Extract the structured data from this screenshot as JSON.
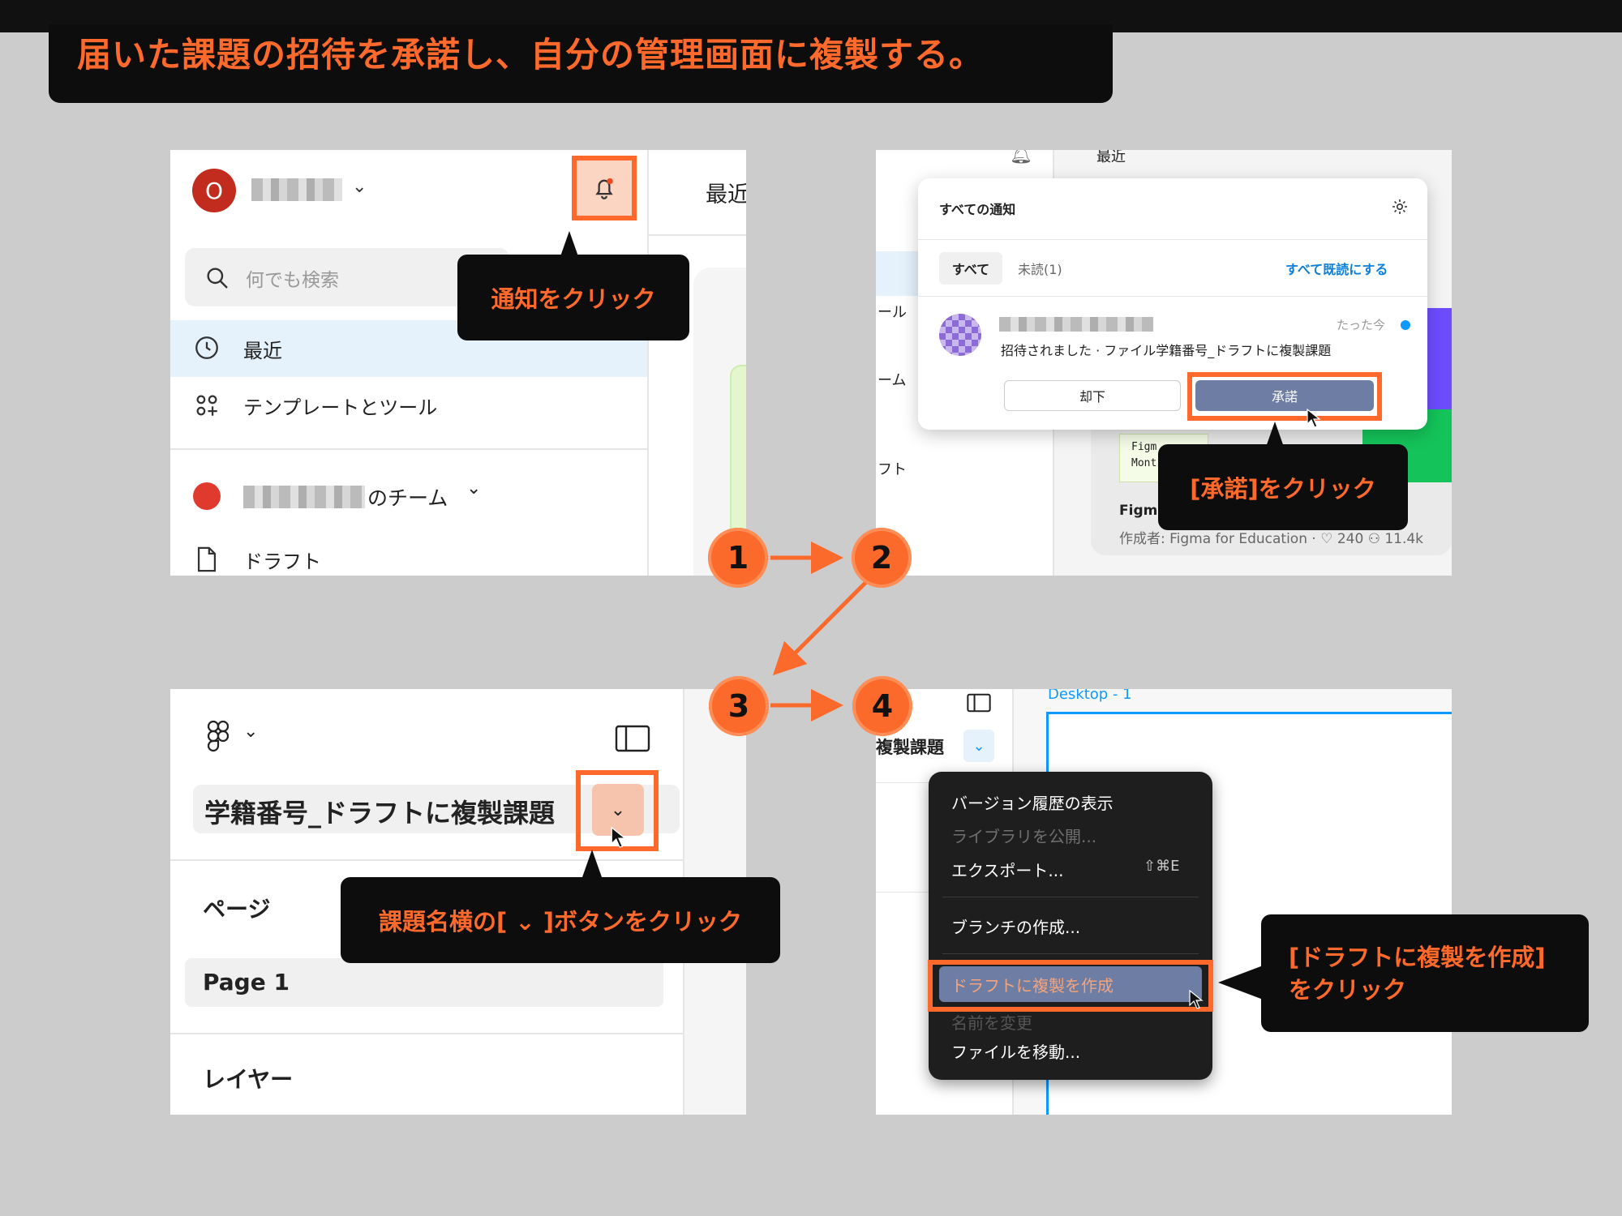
{
  "title": "届いた課題の招待を承諾し、自分の管理画面に複製する。",
  "steps": [
    "1",
    "2",
    "3",
    "4"
  ],
  "panel1": {
    "avatar_letter": "O",
    "search_placeholder": "何でも検索",
    "nav": [
      {
        "label": "最近",
        "icon": "clock-icon"
      },
      {
        "label": "テンプレートとツール",
        "icon": "templates-icon"
      }
    ],
    "team_suffix": "のチーム",
    "drafts_label": "ドラフト",
    "right_tab": "最近"
  },
  "callout1": "通知をクリック",
  "panel2": {
    "header_recent": "最近",
    "notif_title": "すべての通知",
    "tab_all": "すべて",
    "tab_unread": "未読(1)",
    "mark_all_read": "すべて既読にする",
    "time": "たった今",
    "message": "招待されました · ファイル学籍番号_ドラフトに複製課題",
    "decline": "却下",
    "accept": "承諾",
    "side_labels": [
      "ール",
      "ーム",
      "フト"
    ],
    "card_code": "Figm\nMont",
    "card_title": "Figma",
    "card_meta": "作成者: Figma for Education · ♡ 240  ⚇ 11.4k"
  },
  "callout2": "[承諾]をクリック",
  "panel3": {
    "file_name": "学籍番号_ドラフトに複製課題",
    "pages_label": "ページ",
    "page_item": "Page 1",
    "layers_label": "レイヤー"
  },
  "callout3": "課題名横の[ ⌄ ]ボタンをクリック",
  "panel4": {
    "frame_label": "Desktop - 1",
    "file_name_partial": "複製課題",
    "menu": [
      {
        "label": "バージョン履歴の表示",
        "state": "normal",
        "shortcut": ""
      },
      {
        "label": "ライブラリを公開...",
        "state": "disabled",
        "shortcut": ""
      },
      {
        "label": "エクスポート...",
        "state": "normal",
        "shortcut": "⇧⌘E"
      },
      {
        "label": "ブランチの作成...",
        "state": "normal",
        "shortcut": ""
      },
      {
        "label": "ドラフトに複製を作成",
        "state": "selected",
        "shortcut": ""
      },
      {
        "label": "名前を変更",
        "state": "disabled",
        "shortcut": ""
      },
      {
        "label": "ファイルを移動...",
        "state": "normal",
        "shortcut": ""
      }
    ]
  },
  "callout4": "[ドラフトに複製を作成]\nをクリック",
  "colors": {
    "accent": "#ff6a2c",
    "callout_bg": "#0d0d0d",
    "selected_bg": "#e5f1fb",
    "accept_btn": "#6e7da3",
    "figma_blue": "#0d99ff"
  }
}
